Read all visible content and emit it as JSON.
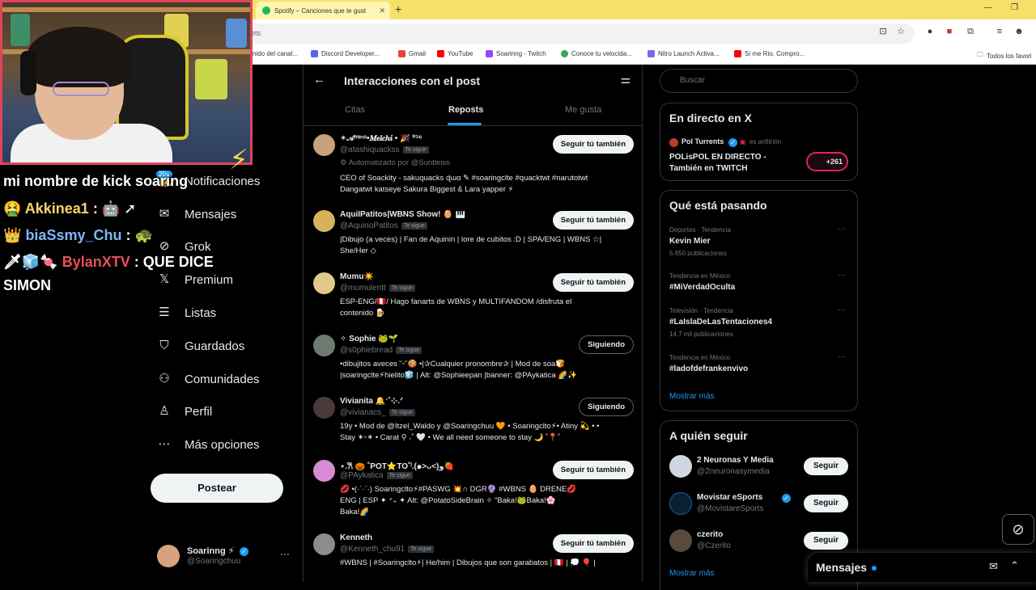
{
  "browser": {
    "tab_title": "Spotify – Canciones que te gust",
    "tab_close": "✕",
    "new_tab": "+",
    "url_fragment": "ets",
    "bookmarks": [
      "nido del canal...",
      "Discord Developer...",
      "Gmail",
      "YouTube",
      "Soarinng - Twitch",
      "Conoce tu velocida...",
      "Nitro Launch Activa...",
      "Si me Rio, Compro..."
    ],
    "bookmarks_folder": "Todos los favori"
  },
  "stream": {
    "chat": [
      {
        "user": "",
        "text": "mi nombre de kick soaring"
      },
      {
        "user": "Akkinea1",
        "text": ":",
        "user_color": "#f5d56a"
      },
      {
        "user": "biaSsmy_Chu",
        "text": ":",
        "user_color": "#7fb6f7"
      },
      {
        "user": "BylanXTV",
        "text": ": QUE DICE",
        "user_color": "#e8505b"
      },
      {
        "user": "",
        "text": "SIMON"
      }
    ],
    "emotes": {
      "akkinea": "🤖 ➚",
      "biassmy": "🐢",
      "bylan": "🗡🧊🍬",
      "medal_1": "🤮",
      "medal_2": "👑",
      "medal_3": "⚔"
    }
  },
  "nav": {
    "items": [
      "Notificaciones",
      "Mensajes",
      "Grok",
      "Premium",
      "Listas",
      "Guardados",
      "Comunidades",
      "Perfil",
      "Más opciones"
    ],
    "icons": [
      "bell-icon",
      "mail-icon",
      "grok-icon",
      "x-icon",
      "list-icon",
      "bookmark-icon",
      "communities-icon",
      "person-icon",
      "more-circle-icon"
    ],
    "notif_badge": "20+",
    "post_button": "Postear",
    "profile": {
      "name": "Soarinng ⚡",
      "handle": "@Soaringchuu",
      "more": "···"
    }
  },
  "center": {
    "title": "Interacciones con el post",
    "tabs": [
      "Citas",
      "Reposts",
      "Me gusta"
    ],
    "active_tab": "Reposts",
    "users": [
      {
        "name": "✶𝒜ᵐᶦⁿᵒ•𝑴𝒆𝒍𝒄𝒉𝒊 • 🎉 ⁰¹⁶",
        "handle": "@atashiquackss",
        "badge": "Te sigue",
        "button": "Seguir tú también",
        "auto": "Automatizado por @Suntleiss",
        "bio": "CEO of Soackity - sakuquacks ɖɯɑ ✎ #soaringclte #quacktwt #narutotwt\nDangatwt katseye Sakura Biggest & Lara yapper ⚡",
        "avatar_color": "#c8a27a"
      },
      {
        "name": "AquiIPatitos|WBNS Show! 🥚 🎹",
        "handle": "@AquinoPatitos",
        "badge": "Te sigue",
        "button": "Seguir tú también",
        "bio": "|Dibujo (a veces) | Fan de Aquinin | lore de cubitos :D | SPA/ENG | WBNS ☆|\nShe/Her ◇",
        "avatar_color": "#d6b25a"
      },
      {
        "name": "Mumu☀️",
        "handle": "@mumulentt",
        "badge": "Te sigue",
        "button": "Seguir tú también",
        "bio": "ESP-ENG/🇵🇪/ Hago fanarts de WBNS y MULTIFANDOM /disfruta el\ncontenido 🍺",
        "avatar_color": "#e0c98a"
      },
      {
        "name": "✧ Sophie 🐸🌱",
        "handle": "@s0phiebread",
        "badge": "Te sigue",
        "button": "Siguiendo",
        "bio": "•dibujitos aveces ˘ᵕ˘🍪 •|✰Cualquier pronombre✰ | Mod de soa🍞\n|soaringclte⚡hielito🧊 | Alt: @Sophieepan |banner: @PAykatica 🌈✨",
        "avatar_color": "#6e7a70"
      },
      {
        "name": "Vivianita 🔔ˑ˚⊹.ᐟ",
        "handle": "@vivianacs_",
        "badge": "Te sigue",
        "button": "Siguiendo",
        "bio": "19y • Mod de @Itzel_Waldo y @Soaringchuu 🧡 • Soaringclto⚡• Atiny 💫 • •\nStay ✶ᵕ✶ • Carat ⚲ ˖˚ 🤍 • We all need someone to stay 🌙 ˚📍˚",
        "avatar_color": "#4b3a3a"
      },
      {
        "name": "⋆.𐙚 🎃 ˚POT⭐TO˚ˡ.(๑˃ᴗ˂)ﻭ🍓",
        "handle": "@PAykatica",
        "badge": "Te sigue",
        "button": "Seguir tú también",
        "bio": "💋 •(·ˋ·ˊ·) Soaringclto⚡#PASWG 💥∩ DGR🔮 #WBNS 🥚 DRENE💋\nENG | ESP ✦ ⁺₊ ✦ Alt: @PotatoSideBrain ✧ \"Baka!🐸Baka!🌸\nBaka!🌈",
        "avatar_color": "#d88ad6"
      },
      {
        "name": "Kenneth",
        "handle": "@Kenneth_chu91",
        "badge": "Te sigue",
        "button": "Seguir tú también",
        "bio": "#WBNS | #Soaringclto⚡| He/him | Dibujos que son garabatos | 🇵🇪 | 💭 🎈 |",
        "avatar_color": "#8c8c8c"
      }
    ]
  },
  "right": {
    "search_placeholder": "Buscar",
    "live": {
      "title": "En directo en X",
      "host": "Pol Turrents",
      "host_role": "es anfitrión",
      "stream_title": "POLisPOL EN DIRECTO -\nTambién en TWITCH",
      "listeners": "+261"
    },
    "trends": {
      "title": "Qué está pasando",
      "items": [
        {
          "meta": "Deportes · Tendencia",
          "title": "Kevin Mier",
          "count": "5.650 publicaciones"
        },
        {
          "meta": "Tendencia en México",
          "title": "#MiVerdadOculta",
          "count": ""
        },
        {
          "meta": "Televisión · Tendencia",
          "title": "#LaIslaDeLasTentaciones4",
          "count": "14,7 mil publicaciones"
        },
        {
          "meta": "Tendencia en México",
          "title": "#ladofdefrankenvivo",
          "count": ""
        }
      ],
      "more": "Mostrar más",
      "dots": "···"
    },
    "who_to_follow": {
      "title": "A quién seguir",
      "items": [
        {
          "name": "2 Neuronas Y Media",
          "handle": "@2neuronasymedia",
          "button": "Seguir",
          "avatar_color": "#d0d7e0"
        },
        {
          "name": "Movistar eSports",
          "handle": "@MovistareSports",
          "button": "Seguir",
          "avatar_color": "#0b1f35"
        },
        {
          "name": "czerito",
          "handle": "@Czerito",
          "button": "Seguir",
          "avatar_color": "#5a4a3c"
        }
      ],
      "more": "Mostrar más"
    }
  },
  "messages_drawer": {
    "title": "Mensajes"
  },
  "colors": {
    "accent": "#1d9bf0",
    "bg": "#000000",
    "border": "#2f3336",
    "muted": "#71767b",
    "tabbar": "#f6e06a"
  }
}
